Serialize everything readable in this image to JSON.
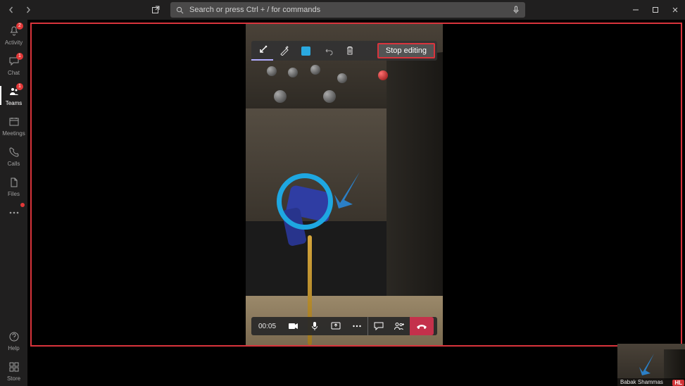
{
  "search": {
    "placeholder": "Search or press Ctrl + / for commands"
  },
  "rail": {
    "items": [
      {
        "label": "Activity",
        "badge": "2"
      },
      {
        "label": "Chat",
        "badge": "1"
      },
      {
        "label": "Teams",
        "badge": "1"
      },
      {
        "label": "Meetings",
        "badge": ""
      },
      {
        "label": "Calls",
        "badge": ""
      },
      {
        "label": "Files",
        "badge": ""
      }
    ],
    "overflow_label": "",
    "help_label": "Help",
    "store_label": "Store"
  },
  "annotation_toolbar": {
    "tools": [
      "arrow",
      "pen",
      "color",
      "undo",
      "delete"
    ],
    "stop_label": "Stop editing",
    "active_color": "#2aa9e0"
  },
  "call_bar": {
    "duration": "00:05"
  },
  "thumbnail": {
    "name": "Babak Shammas",
    "badge": "HL"
  },
  "colors": {
    "highlight_red": "#d9343c",
    "annotation_blue": "#1ea7e1",
    "hangup_red": "#c4314b"
  }
}
